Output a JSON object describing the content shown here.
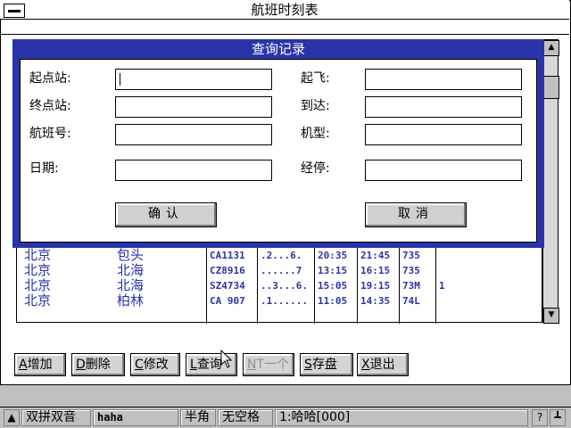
{
  "window": {
    "title": "航班时刻表"
  },
  "dialog": {
    "title": "查询记录",
    "labels": {
      "origin": "起点站:",
      "departure": "起飞:",
      "destination": "终点站:",
      "arrival": "到达:",
      "flight_no": "航班号:",
      "aircraft": "机型:",
      "date": "日期:",
      "via": "经停:"
    },
    "values": {
      "origin": "",
      "departure": "",
      "destination": "",
      "arrival": "",
      "flight_no": "",
      "aircraft": "",
      "date": "",
      "via": ""
    },
    "ok_label": "确认",
    "cancel_label": "取消"
  },
  "flights": [
    {
      "from": "北京",
      "to": "包头",
      "flight": "CA1131",
      "days": ".2...6.",
      "dep": "20:35",
      "arr": "21:45",
      "type": "735",
      "stops": ""
    },
    {
      "from": "北京",
      "to": "北海",
      "flight": "CZ8916",
      "days": "......7",
      "dep": "13:15",
      "arr": "16:15",
      "type": "735",
      "stops": ""
    },
    {
      "from": "北京",
      "to": "北海",
      "flight": "SZ4734",
      "days": "..3...6.",
      "dep": "15:05",
      "arr": "19:15",
      "type": "73M",
      "stops": "1"
    },
    {
      "from": "北京",
      "to": "柏林",
      "flight": "CA 907",
      "days": ".1......",
      "dep": "11:05",
      "arr": "14:35",
      "type": "74L",
      "stops": ""
    }
  ],
  "toolbar": {
    "add": {
      "key": "A",
      "label": "增加"
    },
    "delete": {
      "key": "D",
      "label": "删除"
    },
    "modify": {
      "key": "C",
      "label": "修改"
    },
    "query": {
      "key": "L",
      "label": "查询"
    },
    "disabled": {
      "key": "N",
      "label": "T一个"
    },
    "save": {
      "key": "S",
      "label": "存盘"
    },
    "exit": {
      "key": "X",
      "label": "退出"
    }
  },
  "statusbar": {
    "input_mode": "双拼双音",
    "user": "haha",
    "width": "半角",
    "space": "无空格",
    "candidate": "1:哈哈[000]",
    "help": "?"
  },
  "colors": {
    "dialog_frame": "#2a34a8",
    "list_text": "#2a34a8",
    "background": "#c0c0c0"
  }
}
